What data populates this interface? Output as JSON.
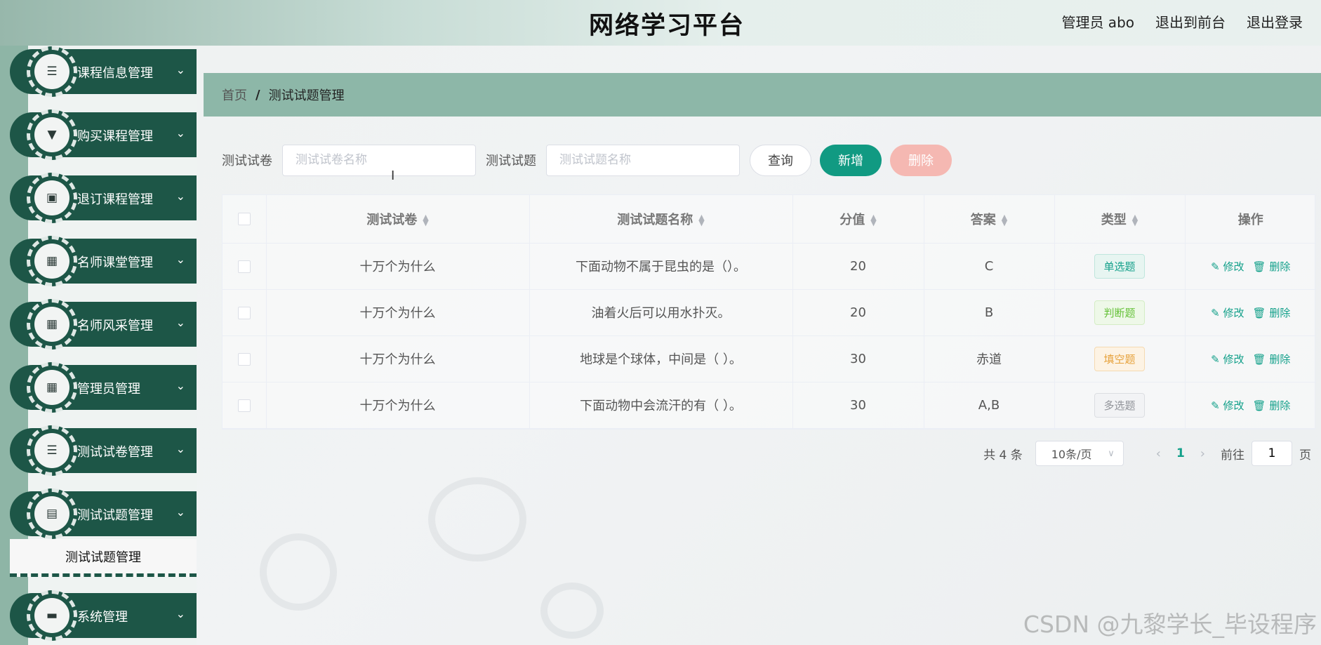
{
  "header": {
    "site_title": "网络学习平台",
    "admin_user": "管理员 abo",
    "to_front": "退出到前台",
    "logout": "退出登录"
  },
  "sidebar": {
    "items": [
      {
        "label": "课程信息管理",
        "icon": "list-icon",
        "glyph": "☰"
      },
      {
        "label": "购买课程管理",
        "icon": "brush-icon",
        "glyph": "▼"
      },
      {
        "label": "退订课程管理",
        "icon": "briefcase-icon",
        "glyph": "▣"
      },
      {
        "label": "名师课堂管理",
        "icon": "grid-icon",
        "glyph": "▦"
      },
      {
        "label": "名师风采管理",
        "icon": "apps-icon",
        "glyph": "▦"
      },
      {
        "label": "管理员管理",
        "icon": "apps-icon",
        "glyph": "▦"
      },
      {
        "label": "测试试卷管理",
        "icon": "document-list-icon",
        "glyph": "☰"
      },
      {
        "label": "测试试题管理",
        "icon": "clipboard-icon",
        "glyph": "▤"
      },
      {
        "label": "系统管理",
        "icon": "chat-icon",
        "glyph": "▬"
      }
    ],
    "submenu_label": "测试试题管理"
  },
  "breadcrumb": {
    "home": "首页",
    "separator": "/",
    "current": "测试试题管理"
  },
  "search": {
    "paper_label": "测试试卷",
    "paper_placeholder": "测试试卷名称",
    "question_label": "测试试题",
    "question_placeholder": "测试试题名称",
    "query_btn": "查询",
    "add_btn": "新增",
    "delete_btn": "删除"
  },
  "table": {
    "headers": [
      "测试试卷",
      "测试试题名称",
      "分值",
      "答案",
      "类型",
      "操作"
    ],
    "rows": [
      {
        "paper": "十万个为什么",
        "question": "下面动物不属于昆虫的是（）。",
        "score": "20",
        "answer": "C",
        "type": "单选题",
        "type_color": "teal"
      },
      {
        "paper": "十万个为什么",
        "question": "油着火后可以用水扑灭。",
        "score": "20",
        "answer": "B",
        "type": "判断题",
        "type_color": "green"
      },
      {
        "paper": "十万个为什么",
        "question": "地球是个球体，中间是（ ）。",
        "score": "30",
        "answer": "赤道",
        "type": "填空题",
        "type_color": "orange"
      },
      {
        "paper": "十万个为什么",
        "question": "下面动物中会流汗的有（ ）。",
        "score": "30",
        "answer": "A,B",
        "type": "多选题",
        "type_color": "gray"
      }
    ],
    "edit_label": "修改",
    "delete_label": "删除"
  },
  "pagination": {
    "total": "共 4 条",
    "page_size": "10条/页",
    "current_page": "1",
    "goto_label": "前往",
    "goto_value": "1",
    "page_suffix": "页"
  },
  "watermark": "CSDN @九黎学长_毕设程序",
  "colors": {
    "sidebar_dark": "#1d5647",
    "accent": "#119a82",
    "breadcrumb_bg": "#8db7a8",
    "danger_light": "#f5b8b2"
  }
}
